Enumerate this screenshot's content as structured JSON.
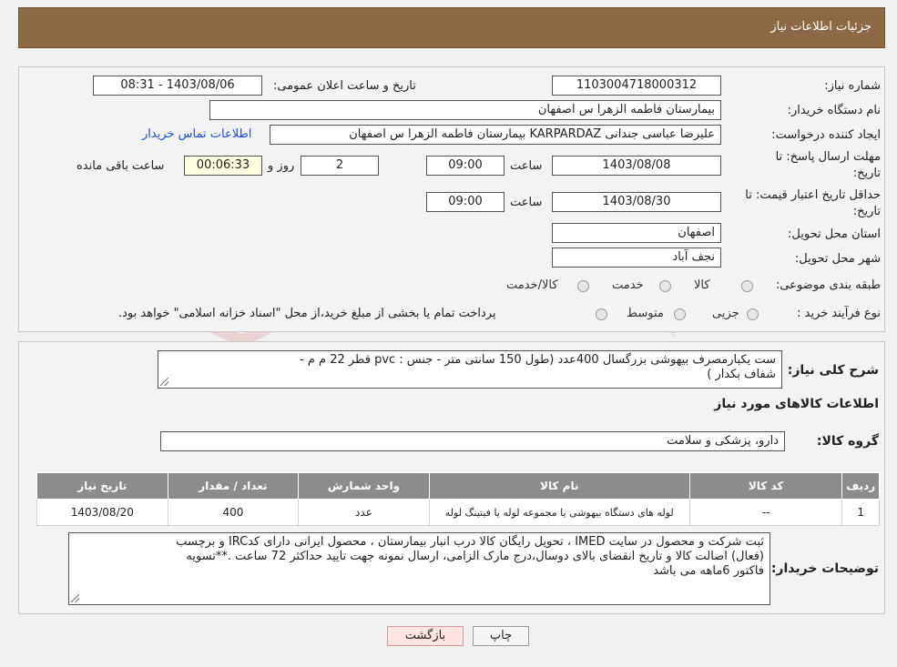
{
  "header": {
    "title": "جزئیات اطلاعات نیاز"
  },
  "fields": {
    "need_number_label": "شماره نیاز:",
    "need_number": "1103004718000312",
    "announce_label": "تاریخ و ساعت اعلان عمومی:",
    "announce_value": "1403/08/06 - 08:31",
    "buyer_org_label": "نام دستگاه خریدار:",
    "buyer_org": "بیمارستان فاطمه الزهرا س  اصفهان",
    "creator_label": "ایجاد کننده درخواست:",
    "creator": "علیرضا عباسی جندانی KARPARDAZ بیمارستان فاطمه الزهرا س  اصفهان",
    "contact_link": "اطلاعات تماس خریدار",
    "deadline_label_1": "مهلت ارسال پاسخ: تا",
    "deadline_label_2": "تاریخ:",
    "deadline_date": "1403/08/08",
    "time_label": "ساعت",
    "deadline_time": "09:00",
    "days_value": "2",
    "days_label": "روز و",
    "remaining_time": "00:06:33",
    "remaining_label": "ساعت باقی مانده",
    "validity_label_1": "حداقل تاریخ اعتبار قیمت: تا",
    "validity_label_2": "تاریخ:",
    "validity_date": "1403/08/30",
    "validity_time": "09:00",
    "province_label": "استان محل تحویل:",
    "province": "اصفهان",
    "city_label": "شهر محل تحویل:",
    "city": "نجف آباد",
    "category_label": "طبقه بندی موضوعی:",
    "category_options": [
      "کالا",
      "خدمت",
      "کالا/خدمت"
    ],
    "process_label": "نوع فرآیند خرید :",
    "process_options": [
      "جزیی",
      "متوسط"
    ],
    "process_note": "پرداخت تمام یا بخشی از مبلغ خرید،از محل \"اسناد خزانه اسلامی\" خواهد بود."
  },
  "description": {
    "label": "شرح کلی نیاز:",
    "line1": "ست یکبارمصرف بیهوشی بزرگسال        400عدد (طول 150 سانتی متر  - جنس : pvc   قطر 22 م م  -",
    "line2": "شفاف بکدار )"
  },
  "goods": {
    "section_title": "اطلاعات کالاهای مورد نیاز",
    "group_label": "گروه کالا:",
    "group_value": "دارو، پزشکی و سلامت",
    "columns": [
      "ردیف",
      "کد کالا",
      "نام کالا",
      "واحد شمارش",
      "تعداد / مقدار",
      "تاریخ نیاز"
    ],
    "rows": [
      [
        "1",
        "--",
        "لوله های دستگاه بیهوشی یا مجموعه لوله یا فیتینگ لوله",
        "عدد",
        "400",
        "1403/08/20"
      ]
    ]
  },
  "buyer_notes": {
    "label": "توضیحات خریدار:",
    "line1": "ثبت شرکت و محصول در سایت IMED ، تحویل رایگان کالا درب انبار بیمارستان ، محصول ایرانی دارای کدIRC و برچسب",
    "line2": "(فعال) اصالت کالا و تاریخ انقضای بالای دوسال،درج مارک الزامی،  ارسال نمونه جهت تایید حداکثر 72 ساعت .**تسویه",
    "line3": "فاکتور 6ماهه می باشد"
  },
  "buttons": {
    "print": "چاپ",
    "back": "بازگشت"
  },
  "colors": {
    "header": "#8b6a45",
    "table_header": "#8c8c8c",
    "link": "#1a4fcf",
    "back_button": "#ffe4e4"
  }
}
